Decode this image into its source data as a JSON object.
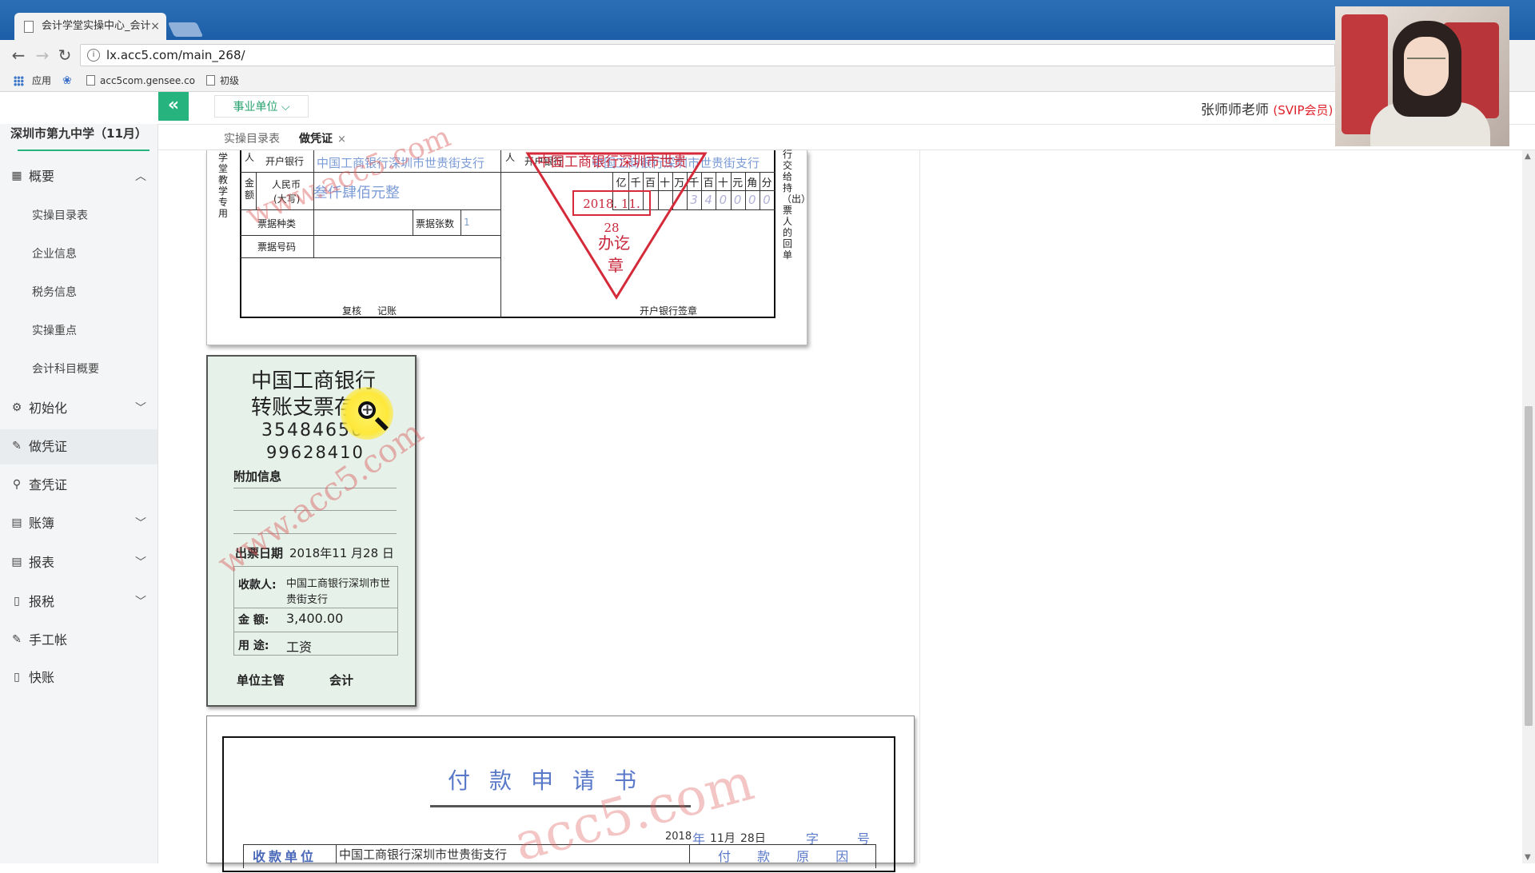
{
  "browser": {
    "tab_title": "会计学堂实操中心_会计",
    "tab_close": "×",
    "url": "lx.acc5.com/main_268/",
    "bookmarks": [
      "应用",
      "acc5com.gensee.co",
      "初级"
    ]
  },
  "header": {
    "collapse_label": "«",
    "org_type": "事业单位 ⌵",
    "user_name": "张师师老师",
    "user_badge": "(SVIP会员)"
  },
  "sidebar": {
    "school": "深圳市第九中学（11月）",
    "menu": [
      {
        "label": "概要",
        "icon": "grid-icon",
        "expanded": true
      },
      {
        "label": "初始化",
        "icon": "gear-icon"
      },
      {
        "label": "做凭证",
        "icon": "pen-icon",
        "active": true
      },
      {
        "label": "查凭证",
        "icon": "search-icon"
      },
      {
        "label": "账簿",
        "icon": "book-icon"
      },
      {
        "label": "报表",
        "icon": "report-icon"
      },
      {
        "label": "报税",
        "icon": "doc-icon"
      },
      {
        "label": "手工帐",
        "icon": "pen-icon"
      },
      {
        "label": "快账",
        "icon": "doc-icon"
      }
    ],
    "submenu": [
      "实操目录表",
      "企业信息",
      "税务信息",
      "实操重点",
      "会计科目概要"
    ]
  },
  "tabs": [
    {
      "label": "实操目录表"
    },
    {
      "label": "做凭证",
      "close": "×",
      "active": true
    }
  ],
  "receipt": {
    "left_vertical": "学堂教学专用",
    "right_vertical": "行交给持（出）票人的回单",
    "payer_label": "人",
    "payer_bank_label": "开户银行",
    "payer_bank": "中国工商银行深圳市世贵街支行",
    "payee_label": "人",
    "payee_bank_label": "开户银行",
    "payee_bank": "中国工商银行深圳市世贵街支行",
    "amount_label": "金额",
    "rmb_label": "人民币",
    "rmb_sub": "(大写)",
    "amount_words": "叁仟肆佰元整",
    "units": [
      "亿",
      "千",
      "百",
      "十",
      "万",
      "千",
      "百",
      "十",
      "元",
      "角",
      "分"
    ],
    "amount_digits": [
      "3",
      "4",
      "0",
      "0",
      "0",
      "0"
    ],
    "bill_type_label": "票据种类",
    "bill_count_label": "票据张数",
    "bill_count": "1",
    "bill_no_label": "票据号码",
    "review_label": "复核",
    "record_label": "记账",
    "bank_sign_label": "开户银行签章",
    "stamp_bank": "中国工商银行深圳市世贵",
    "stamp_date": "2018. 11. 28",
    "stamp_done_1": "办讫",
    "stamp_done_2": "章"
  },
  "cheque_stub": {
    "bank": "中国工商银行",
    "title": "转账支票存根",
    "code1": "35484656",
    "code2": "99628410",
    "extra_info_label": "附加信息",
    "date_label": "出票日期",
    "date_value": "2018年11 月28 日",
    "payee_label": "收款人:",
    "payee_value": "中国工商银行深圳市世贵街支行",
    "amount_label": "金 额:",
    "amount_value": "3,400.00",
    "use_label": "用 途:",
    "use_value": "工资",
    "manager_label": "单位主管",
    "accountant_label": "会计"
  },
  "payment_form": {
    "title": "付款申请书",
    "date_year": "2018",
    "date_year_unit": "年",
    "date_month": "11月",
    "date_day": "28日",
    "zi_label": "字",
    "hao_label": "号",
    "payee_unit_label": "收款单位",
    "payee_unit_value": "中国工商银行深圳市世贵街支行",
    "reason_label": "付 款 原 因"
  },
  "watermarks": [
    "www.acc5.com",
    "www.acc5.com",
    "acc5.com"
  ]
}
